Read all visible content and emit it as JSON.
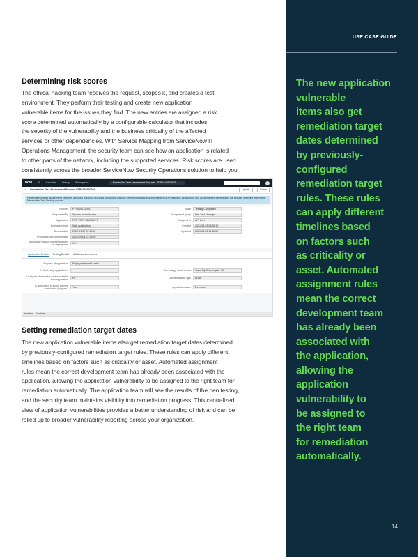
{
  "header": {
    "label": "USE CASE GUIDE"
  },
  "section1": {
    "title": "Determining risk scores",
    "lines": [
      "The ethical hacking team receives the request, scopes it, and creates a test",
      "environment. They perform their testing and create new application",
      "vulnerable items for the issues they find. The new entries are assigned a risk",
      "score determined automatically by a configurable calculator that includes",
      "the severity of the vulnerability and the business criticality of the affected",
      "services or other dependencies. With Service Mapping from ServiceNow IT",
      "Operations Management, the security team can see how an application is related",
      "to other parts of the network, including the supported services. Risk scores are used",
      "consistently across the broader ServiceNow Security Operations solution to help you",
      "understand your overall security posture."
    ]
  },
  "screenshot": {
    "nav": [
      "All",
      "Favorites",
      "History",
      "Workspaces"
    ],
    "context": "Penetration Test Assessment Request - PTR0100120001",
    "record_title": "Penetration Test Assessment Request PTR0100120001",
    "buttons": [
      "Update",
      "Delete"
    ],
    "info": "Penetration testing assessment requests are used to submit requests to security team for performing a security assessment of an business application. Any vulnerabilities identified by the security team are entered as Penetration Test Finding records.",
    "fields": [
      {
        "label": "Number",
        "value": "PTR0100120001"
      },
      {
        "label": "State",
        "value": "Testing Completed"
      },
      {
        "label": "Requested By",
        "value": "System Administrator"
      },
      {
        "label": "Assignment group",
        "value": "Pen Test Manager"
      },
      {
        "label": "Application",
        "value": "PEN TEST DEMO APP"
      },
      {
        "label": "Assigned to",
        "value": "API Cert"
      },
      {
        "label": "Application type",
        "value": "Web Application"
      },
      {
        "label": "Created",
        "value": "2021-03-03 08:35:10"
      },
      {
        "label": "Desired date",
        "value": "2022-09-07 00:19:20"
      },
      {
        "label": "Updated",
        "value": "2021-03-03 11:38:09"
      },
      {
        "label": "Production deployment date",
        "value": "2022-09-04 01:19:20"
      },
      {
        "label": "",
        "value": ""
      },
      {
        "label": "Application version number planned for deployment",
        "value": "1.0"
      }
    ],
    "tabs": [
      "Application Details",
      "Testing Details",
      "Additional Comments"
    ],
    "details": [
      {
        "label": "Purpose of application",
        "value": "Employee benefit portal"
      },
      {
        "label": "",
        "value": ""
      },
      {
        "label": "Is third party application?",
        "value": ""
      },
      {
        "label": "Technology stack details",
        "value": "Java, MySQL, Angular JS"
      },
      {
        "label": "List types of sensitive data accessible from application",
        "value": "PII"
      },
      {
        "label": "Authentication type",
        "value": "LDAP"
      },
      {
        "label": "Is application in scope for new compliance program?",
        "value": "Yes"
      },
      {
        "label": "Application team",
        "value": "Developer"
      }
    ],
    "footer_tabs": [
      "Vendors",
      "Modules"
    ]
  },
  "section2": {
    "title": "Setting remediation target dates",
    "lines": [
      "The new application vulnerable items also get remediation target dates determined",
      "by previously-configured remediation target rules. These rules can apply different",
      "timelines based on factors such as criticality or asset. Automated assignment",
      "rules mean the correct development team has already been associated with the",
      "application, allowing the application vulnerability to be assigned to the right team for",
      "remediation automatically. The application team will see the results of the pen testing,",
      "and the security team maintains visibility into remediation progress. This centralized",
      "view of application vulnerabilities provides a better understanding of risk and can be",
      "rolled up to broader vulnerability reporting across your organization."
    ]
  },
  "pull_quote": {
    "lines": [
      "The new application",
      "vulnerable",
      "items also get",
      "remediation target",
      "dates determined",
      "by previously-",
      "configured",
      "remediation target",
      "rules. These rules",
      "can apply different",
      "timelines based",
      "on factors such",
      "as criticality or",
      "asset. Automated",
      "assignment rules",
      "mean the correct",
      "development team",
      "has already been",
      "associated with",
      "the application,",
      "allowing the",
      "application",
      "vulnerability to",
      "be assigned to",
      "the right team",
      "for remediation",
      "automatically."
    ]
  },
  "page_number": "14",
  "colors": {
    "sidebar": "#0f2b3e",
    "accent": "#62d84e"
  }
}
